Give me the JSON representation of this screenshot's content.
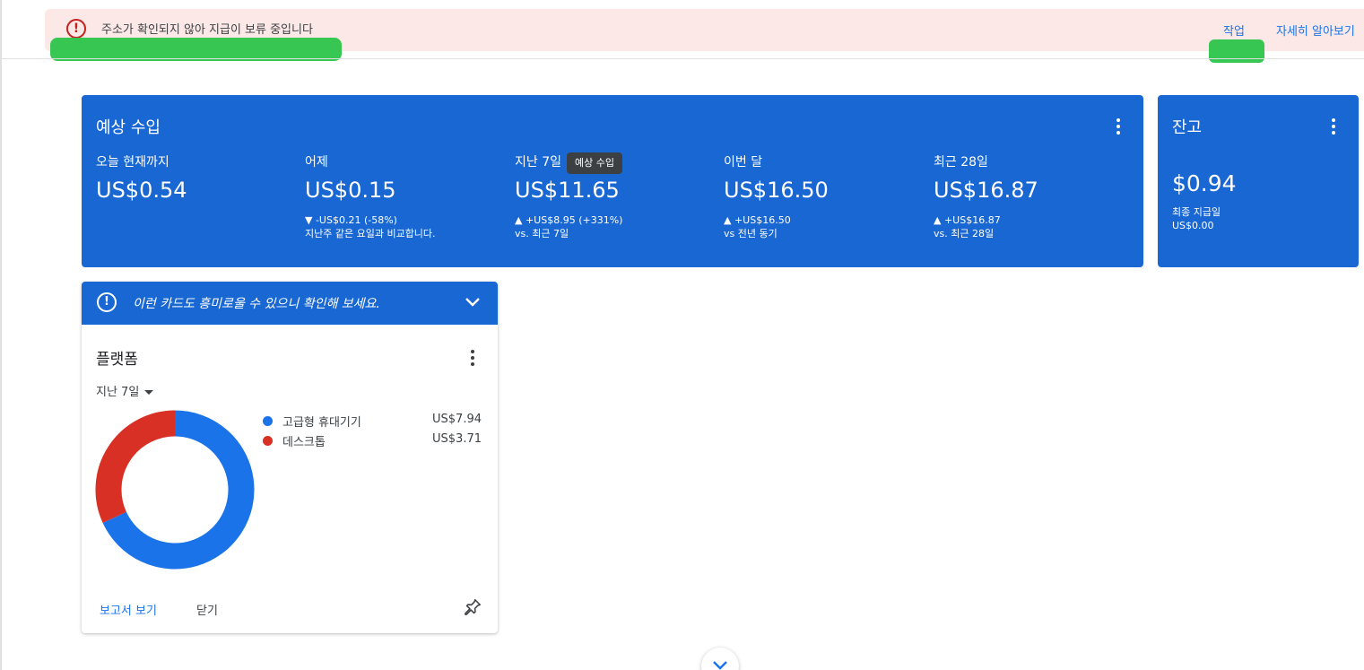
{
  "banner": {
    "message": "주소가 확인되지 않아 지급이 보류 중입니다",
    "actions": [
      {
        "label": "작업"
      },
      {
        "label": "자세히 알아보기"
      }
    ]
  },
  "earnings": {
    "title": "예상 수입",
    "tooltip": "예상 수입",
    "metrics": [
      {
        "label": "오늘 현재까지",
        "value": "US$0.54",
        "change": "",
        "compare": ""
      },
      {
        "label": "어제",
        "value": "US$0.15",
        "change": "▼ -US$0.21 (-58%)",
        "compare": "지난주 같은 요일과 비교합니다."
      },
      {
        "label": "지난 7일",
        "value": "US$11.65",
        "change": "▲ +US$8.95 (+331%)",
        "compare": "vs. 최근 7일"
      },
      {
        "label": "이번 달",
        "value": "US$16.50",
        "change": "▲ +US$16.50",
        "compare": "vs 전년 동기"
      },
      {
        "label": "최근 28일",
        "value": "US$16.87",
        "change": "▲ +US$16.87",
        "compare": "vs. 최근 28일"
      }
    ]
  },
  "balance": {
    "title": "잔고",
    "value": "$0.94",
    "payout_label": "최종 지급일",
    "payout_amount": "US$0.00"
  },
  "platform_card": {
    "tip": "이런 카드도 흥미로울 수 있으니 확인해 보세요.",
    "title": "플랫폼",
    "range": "지난 7일",
    "view_report": "보고서 보기",
    "close": "닫기"
  },
  "chart_data": {
    "type": "pie",
    "categories": [
      "고급형 휴대기기",
      "데스크톱"
    ],
    "values": [
      7.94,
      3.71
    ],
    "value_labels": [
      "US$7.94",
      "US$3.71"
    ],
    "colors": [
      "#1a73e8",
      "#d93025"
    ],
    "donut": true,
    "legend": "right"
  },
  "icons": {
    "banner": "error-icon",
    "tip": "lightbulb-icon",
    "menu": "more-vert-icon",
    "expand": "chevron-down-icon",
    "pin": "pin-icon"
  },
  "colors": {
    "primary": "#1967d2",
    "link": "#1a73e8",
    "error": "#c5221f",
    "banner_bg": "#fce8e6"
  }
}
